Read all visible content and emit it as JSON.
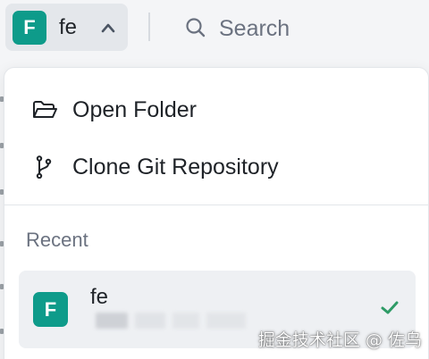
{
  "header": {
    "project": {
      "avatar_letter": "F",
      "name": "fe",
      "avatar_color": "#0e9b8a"
    },
    "search": {
      "placeholder": "Search"
    }
  },
  "dropdown": {
    "actions": [
      {
        "label": "Open Folder",
        "icon": "folder-open-icon"
      },
      {
        "label": "Clone Git Repository",
        "icon": "git-branch-icon"
      }
    ],
    "recent": {
      "title": "Recent",
      "items": [
        {
          "avatar_letter": "F",
          "name": "fe",
          "selected": true
        }
      ]
    }
  },
  "watermark": "掘金技术社区 @ 佐乌",
  "colors": {
    "accent": "#0e9b8a",
    "check": "#2e9b66",
    "muted_text": "#6b7280"
  }
}
